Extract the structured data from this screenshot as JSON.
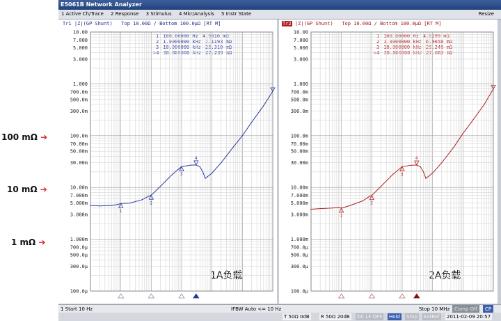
{
  "window": {
    "title": "E5061B Network Analyzer",
    "menu": [
      "1 Active Ch/Trace",
      "2 Response",
      "3 Stimulus",
      "4 Mkr/Analysis",
      "5 Instr State"
    ],
    "resize_label": "Resize"
  },
  "left_trace": {
    "header_id": "Tr1",
    "header_text": "|Z|(GP Shunt)   Top 10.00Ω / Bottom 100.0μΩ [RT M]",
    "panel_label": "1A负载",
    "markers": [
      {
        "id": "1",
        "freq": "100.00000 Hz",
        "value": "4.9016 mΩ"
      },
      {
        "id": "2",
        "freq": "1.0000000 kHz",
        "value": "7.1193 mΩ"
      },
      {
        "id": "3",
        "freq": "10.000000 kHz",
        "value": "25.310 mΩ"
      },
      {
        "id": ">4",
        "freq": "30.000000 kHz",
        "value": "27.239 mΩ"
      }
    ]
  },
  "right_trace": {
    "header_id": "Tr2",
    "header_text": "|Z|(GP Shunt)   Top 10.00Ω / Bottom 100.0μΩ [RT M]",
    "panel_label": "2A负载",
    "markers": [
      {
        "id": "1",
        "freq": "100.00000 Hz",
        "value": "4.0299 mΩ"
      },
      {
        "id": "2",
        "freq": "1.0000000 kHz",
        "value": "6.9658 mΩ"
      },
      {
        "id": "3",
        "freq": "10.000000 kHz",
        "value": "25.249 mΩ"
      },
      {
        "id": ">4",
        "freq": "30.000000 kHz",
        "value": "27.083 mΩ"
      }
    ]
  },
  "status": {
    "start": "1  Start 10 Hz",
    "ifbw": "IFBW Auto <= 10 Hz",
    "stop": "Stop 10 MHz",
    "comp": "Comp Off",
    "cp": "CP"
  },
  "bottom": {
    "t_port": "T 50Ω 0dB",
    "r_port": "R 50Ω 20dB",
    "dclf": "DC LF OFF",
    "hold": "Hold",
    "stop": "Stop",
    "extref": "ExtRef",
    "datetime": "2011-02-09 20:57"
  },
  "annotations": {
    "label_100m": "100 mΩ",
    "label_10m": "10 mΩ",
    "label_1m": "1 mΩ",
    "arrow": "➔"
  },
  "chart_data": [
    {
      "type": "line",
      "title": "",
      "xlabel": "",
      "ylabel": "",
      "x_scale": "log",
      "y_scale": "log",
      "xlim": [
        10,
        10000000
      ],
      "ylim": [
        0.0001,
        10
      ],
      "yticks": [
        "10.00",
        "7.000",
        "5.000",
        "3.000",
        "1.000",
        "700.0m",
        "500.0m",
        "300.0m",
        "100.0m",
        "70.00m",
        "50.00m",
        "30.00m",
        "10.00m",
        "7.000m",
        "5.000m",
        "3.000m",
        "1.000m",
        "700.0μ",
        "500.0μ",
        "300.0μ",
        "100.0μ"
      ],
      "series": [
        {
          "name": "Tr1",
          "color": "#2a3a9c",
          "x": [
            10,
            20,
            50,
            80,
            100,
            200,
            500,
            800,
            1000,
            2000,
            5000,
            10000,
            20000,
            30000,
            40000,
            50000,
            60000,
            70000,
            100000,
            200000,
            500000,
            1000000,
            2000000,
            5000000,
            10000000
          ],
          "y": [
            0.0045,
            0.0044,
            0.0045,
            0.0047,
            0.0049,
            0.005,
            0.0058,
            0.0067,
            0.0071,
            0.0105,
            0.018,
            0.0253,
            0.027,
            0.0272,
            0.025,
            0.02,
            0.015,
            0.016,
            0.019,
            0.03,
            0.06,
            0.1,
            0.18,
            0.38,
            0.72
          ]
        }
      ]
    },
    {
      "type": "line",
      "title": "",
      "xlabel": "",
      "ylabel": "",
      "x_scale": "log",
      "y_scale": "log",
      "xlim": [
        10,
        10000000
      ],
      "ylim": [
        0.0001,
        10
      ],
      "yticks": [
        "10.00",
        "7.000",
        "5.000",
        "3.000",
        "1.000",
        "700.0m",
        "500.0m",
        "300.0m",
        "100.0m",
        "70.00m",
        "50.00m",
        "30.00m",
        "10.00m",
        "7.000m",
        "5.000m",
        "3.000m",
        "1.000m",
        "700.0μ",
        "500.0μ",
        "300.0μ",
        "100.0μ"
      ],
      "series": [
        {
          "name": "Tr2",
          "color": "#b02020",
          "x": [
            10,
            20,
            50,
            80,
            100,
            200,
            500,
            800,
            1000,
            2000,
            5000,
            10000,
            20000,
            30000,
            40000,
            50000,
            60000,
            70000,
            100000,
            200000,
            500000,
            1000000,
            2000000,
            5000000,
            10000000
          ],
          "y": [
            0.0038,
            0.0039,
            0.004,
            0.0041,
            0.004,
            0.0045,
            0.0055,
            0.0066,
            0.007,
            0.0105,
            0.018,
            0.0252,
            0.0268,
            0.0271,
            0.025,
            0.02,
            0.015,
            0.016,
            0.019,
            0.03,
            0.06,
            0.11,
            0.19,
            0.4,
            0.8
          ]
        }
      ]
    }
  ]
}
